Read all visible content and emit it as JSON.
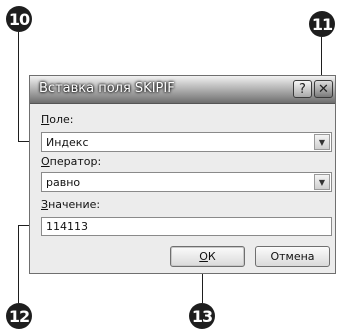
{
  "callouts": {
    "c10": "10",
    "c11": "11",
    "c12": "12",
    "c13": "13"
  },
  "dialog": {
    "title": "Вставка поля SKIPIF",
    "help_label": "?",
    "close_label": "✕",
    "field": {
      "label_u": "П",
      "label_rest": "оле:",
      "value": "Индекс"
    },
    "operator": {
      "label_u": "О",
      "label_rest": "ператор:",
      "value": "равно"
    },
    "value_field": {
      "label_u": "З",
      "label_rest": "начение:",
      "value": "114113"
    },
    "ok_u": "О",
    "ok_rest": "К",
    "cancel_label": "Отмена"
  },
  "icons": {
    "dropdown_arrow": "▼"
  }
}
